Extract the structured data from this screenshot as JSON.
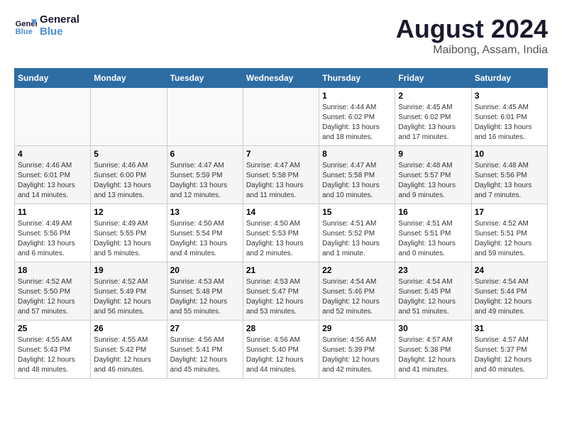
{
  "header": {
    "logo_line1": "General",
    "logo_line2": "Blue",
    "main_title": "August 2024",
    "sub_title": "Maibong, Assam, India"
  },
  "days_of_week": [
    "Sunday",
    "Monday",
    "Tuesday",
    "Wednesday",
    "Thursday",
    "Friday",
    "Saturday"
  ],
  "weeks": [
    [
      {
        "day": "",
        "info": ""
      },
      {
        "day": "",
        "info": ""
      },
      {
        "day": "",
        "info": ""
      },
      {
        "day": "",
        "info": ""
      },
      {
        "day": "1",
        "info": "Sunrise: 4:44 AM\nSunset: 6:02 PM\nDaylight: 13 hours\nand 18 minutes."
      },
      {
        "day": "2",
        "info": "Sunrise: 4:45 AM\nSunset: 6:02 PM\nDaylight: 13 hours\nand 17 minutes."
      },
      {
        "day": "3",
        "info": "Sunrise: 4:45 AM\nSunset: 6:01 PM\nDaylight: 13 hours\nand 16 minutes."
      }
    ],
    [
      {
        "day": "4",
        "info": "Sunrise: 4:46 AM\nSunset: 6:01 PM\nDaylight: 13 hours\nand 14 minutes."
      },
      {
        "day": "5",
        "info": "Sunrise: 4:46 AM\nSunset: 6:00 PM\nDaylight: 13 hours\nand 13 minutes."
      },
      {
        "day": "6",
        "info": "Sunrise: 4:47 AM\nSunset: 5:59 PM\nDaylight: 13 hours\nand 12 minutes."
      },
      {
        "day": "7",
        "info": "Sunrise: 4:47 AM\nSunset: 5:58 PM\nDaylight: 13 hours\nand 11 minutes."
      },
      {
        "day": "8",
        "info": "Sunrise: 4:47 AM\nSunset: 5:58 PM\nDaylight: 13 hours\nand 10 minutes."
      },
      {
        "day": "9",
        "info": "Sunrise: 4:48 AM\nSunset: 5:57 PM\nDaylight: 13 hours\nand 9 minutes."
      },
      {
        "day": "10",
        "info": "Sunrise: 4:48 AM\nSunset: 5:56 PM\nDaylight: 13 hours\nand 7 minutes."
      }
    ],
    [
      {
        "day": "11",
        "info": "Sunrise: 4:49 AM\nSunset: 5:56 PM\nDaylight: 13 hours\nand 6 minutes."
      },
      {
        "day": "12",
        "info": "Sunrise: 4:49 AM\nSunset: 5:55 PM\nDaylight: 13 hours\nand 5 minutes."
      },
      {
        "day": "13",
        "info": "Sunrise: 4:50 AM\nSunset: 5:54 PM\nDaylight: 13 hours\nand 4 minutes."
      },
      {
        "day": "14",
        "info": "Sunrise: 4:50 AM\nSunset: 5:53 PM\nDaylight: 13 hours\nand 2 minutes."
      },
      {
        "day": "15",
        "info": "Sunrise: 4:51 AM\nSunset: 5:52 PM\nDaylight: 13 hours\nand 1 minute."
      },
      {
        "day": "16",
        "info": "Sunrise: 4:51 AM\nSunset: 5:51 PM\nDaylight: 13 hours\nand 0 minutes."
      },
      {
        "day": "17",
        "info": "Sunrise: 4:52 AM\nSunset: 5:51 PM\nDaylight: 12 hours\nand 59 minutes."
      }
    ],
    [
      {
        "day": "18",
        "info": "Sunrise: 4:52 AM\nSunset: 5:50 PM\nDaylight: 12 hours\nand 57 minutes."
      },
      {
        "day": "19",
        "info": "Sunrise: 4:52 AM\nSunset: 5:49 PM\nDaylight: 12 hours\nand 56 minutes."
      },
      {
        "day": "20",
        "info": "Sunrise: 4:53 AM\nSunset: 5:48 PM\nDaylight: 12 hours\nand 55 minutes."
      },
      {
        "day": "21",
        "info": "Sunrise: 4:53 AM\nSunset: 5:47 PM\nDaylight: 12 hours\nand 53 minutes."
      },
      {
        "day": "22",
        "info": "Sunrise: 4:54 AM\nSunset: 5:46 PM\nDaylight: 12 hours\nand 52 minutes."
      },
      {
        "day": "23",
        "info": "Sunrise: 4:54 AM\nSunset: 5:45 PM\nDaylight: 12 hours\nand 51 minutes."
      },
      {
        "day": "24",
        "info": "Sunrise: 4:54 AM\nSunset: 5:44 PM\nDaylight: 12 hours\nand 49 minutes."
      }
    ],
    [
      {
        "day": "25",
        "info": "Sunrise: 4:55 AM\nSunset: 5:43 PM\nDaylight: 12 hours\nand 48 minutes."
      },
      {
        "day": "26",
        "info": "Sunrise: 4:55 AM\nSunset: 5:42 PM\nDaylight: 12 hours\nand 46 minutes."
      },
      {
        "day": "27",
        "info": "Sunrise: 4:56 AM\nSunset: 5:41 PM\nDaylight: 12 hours\nand 45 minutes."
      },
      {
        "day": "28",
        "info": "Sunrise: 4:56 AM\nSunset: 5:40 PM\nDaylight: 12 hours\nand 44 minutes."
      },
      {
        "day": "29",
        "info": "Sunrise: 4:56 AM\nSunset: 5:39 PM\nDaylight: 12 hours\nand 42 minutes."
      },
      {
        "day": "30",
        "info": "Sunrise: 4:57 AM\nSunset: 5:38 PM\nDaylight: 12 hours\nand 41 minutes."
      },
      {
        "day": "31",
        "info": "Sunrise: 4:57 AM\nSunset: 5:37 PM\nDaylight: 12 hours\nand 40 minutes."
      }
    ]
  ]
}
